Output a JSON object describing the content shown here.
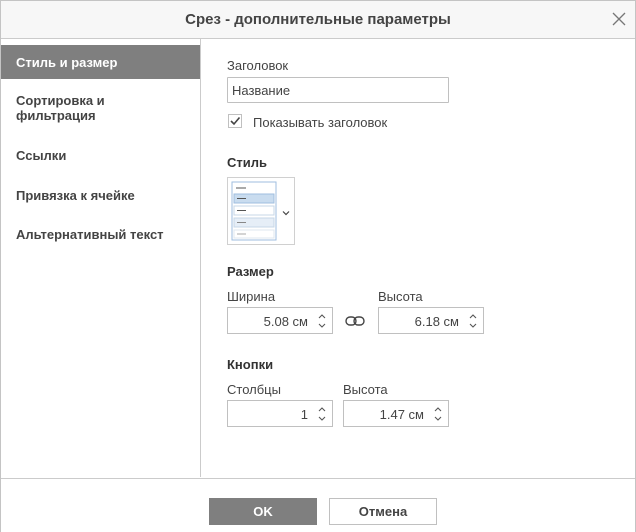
{
  "dialog": {
    "title": "Срез - дополнительные параметры"
  },
  "sidebar": {
    "items": [
      {
        "lines": [
          "Стиль и размер"
        ],
        "active": true
      },
      {
        "lines": [
          "Сортировка и",
          "фильтрация"
        ],
        "active": false
      },
      {
        "lines": [
          "Ссылки"
        ],
        "active": false
      },
      {
        "lines": [
          "Привязка к ячейке"
        ],
        "active": false
      },
      {
        "lines": [
          "Альтернативный текст"
        ],
        "active": false
      }
    ]
  },
  "style_size": {
    "header_label": "Заголовок",
    "header_value": "Название",
    "show_header_label": "Показывать заголовок",
    "show_header_checked": true,
    "style_label": "Стиль",
    "size_label": "Размер",
    "width_label": "Ширина",
    "width_value": "5.08 см",
    "height_label": "Высота",
    "height_value": "6.18 см",
    "buttons_label": "Кнопки",
    "columns_label": "Столбцы",
    "columns_value": "1",
    "button_height_label": "Высота",
    "button_height_value": "1.47 см"
  },
  "footer": {
    "ok_label": "OK",
    "cancel_label": "Отмена"
  },
  "colors": {
    "active_bg": "#7f7f7f",
    "border": "#c0c0c0",
    "preview_blue": "#c9dcef"
  },
  "icons": [
    "close-icon",
    "check-icon",
    "chevron-down-icon",
    "link-icon",
    "spin-up-icon",
    "spin-down-icon"
  ]
}
